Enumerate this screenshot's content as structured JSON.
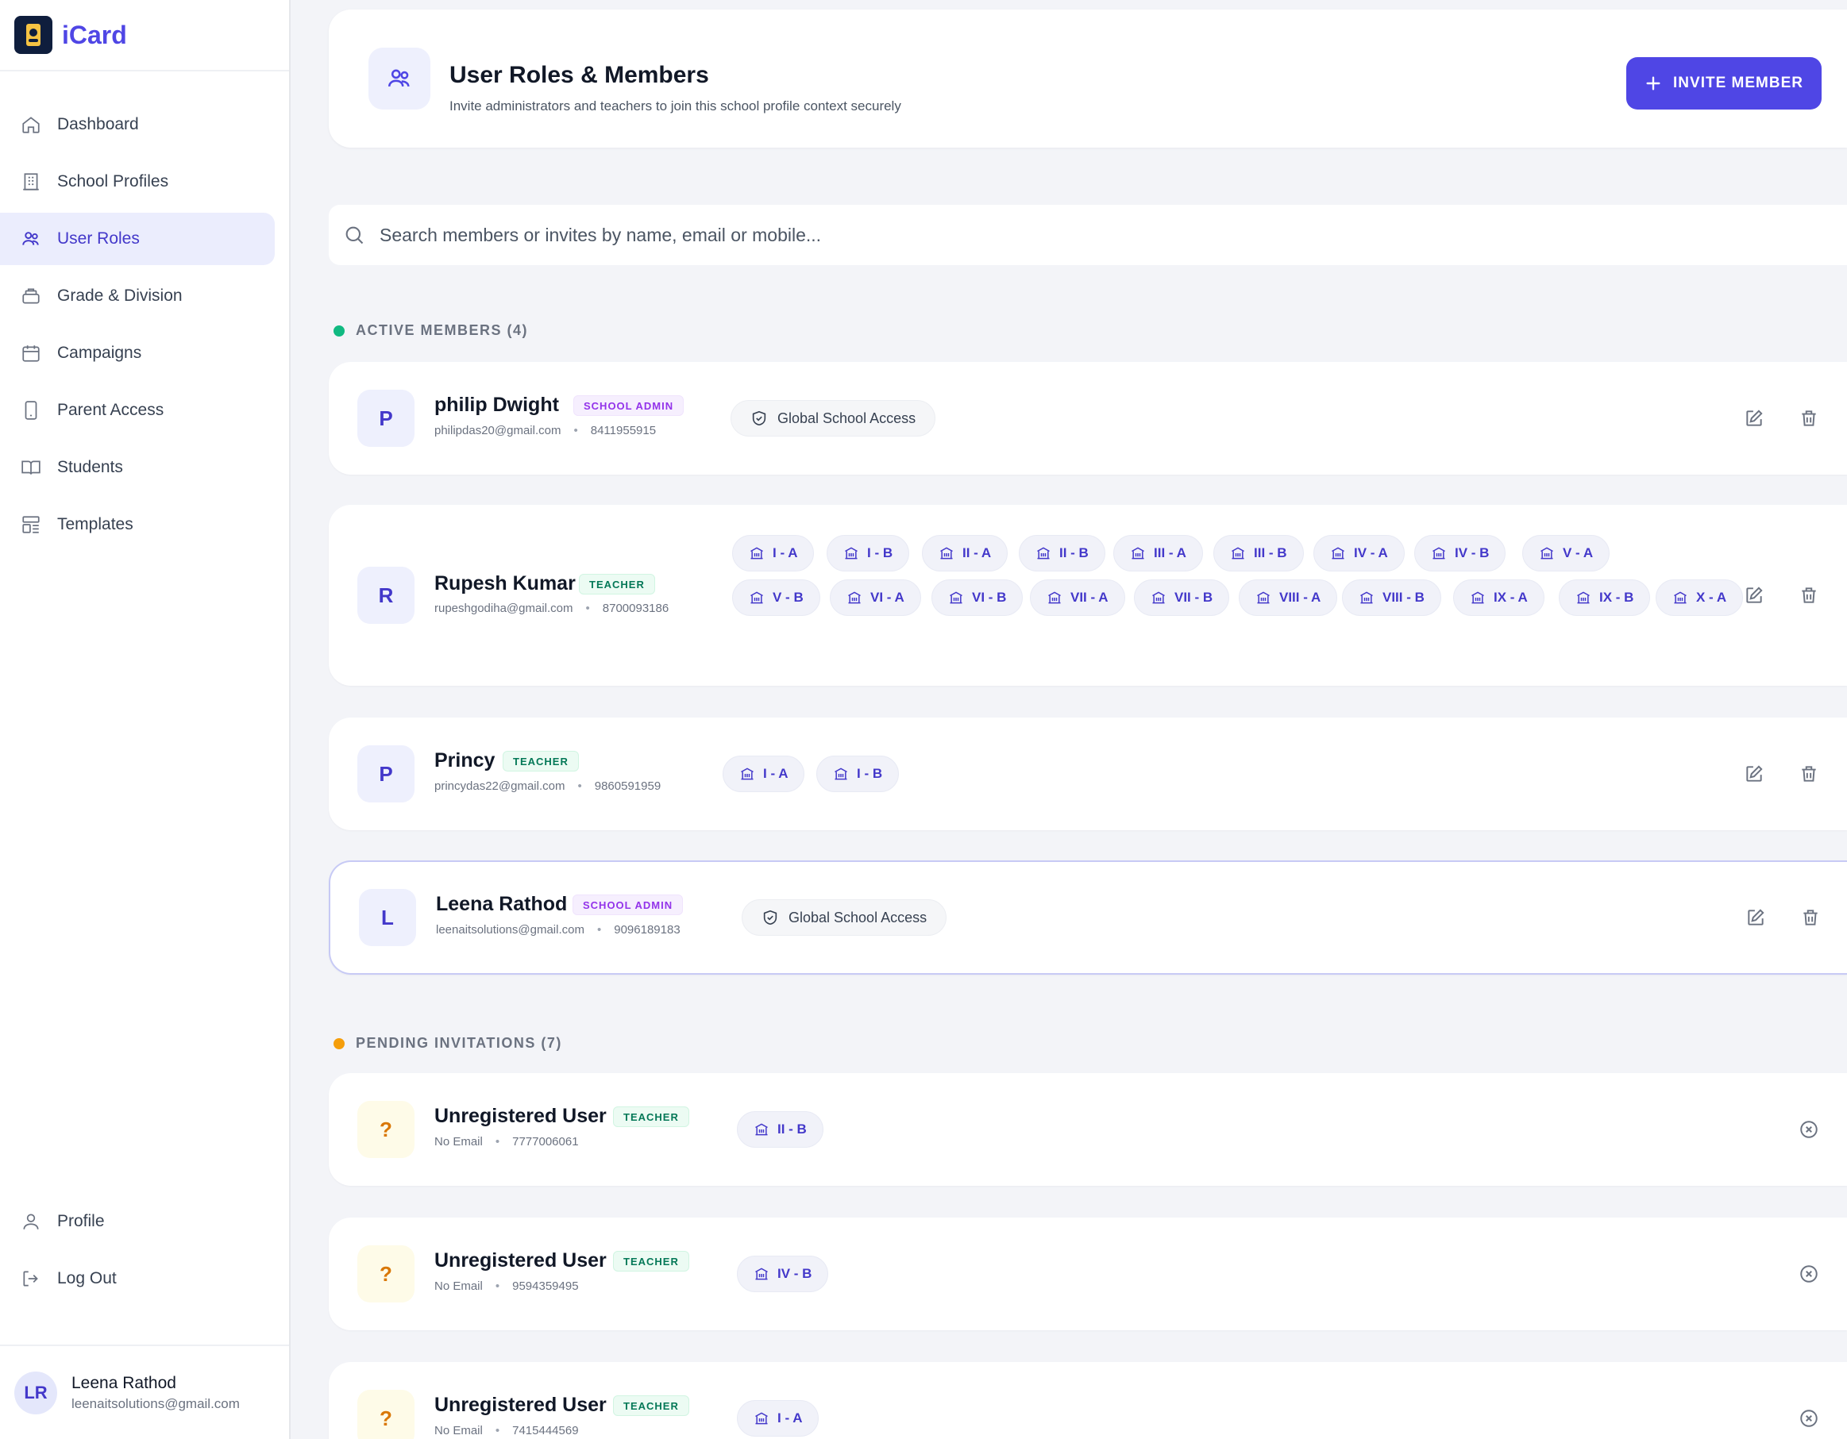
{
  "app": {
    "name": "iCard"
  },
  "sidebar": {
    "nav": [
      {
        "label": "Dashboard",
        "icon": "home-icon"
      },
      {
        "label": "School Profiles",
        "icon": "building-icon"
      },
      {
        "label": "User Roles",
        "icon": "users-icon",
        "active": true
      },
      {
        "label": "Grade & Division",
        "icon": "layers-icon"
      },
      {
        "label": "Campaigns",
        "icon": "calendar-icon"
      },
      {
        "label": "Parent Access",
        "icon": "tablet-icon"
      },
      {
        "label": "Students",
        "icon": "book-icon"
      },
      {
        "label": "Templates",
        "icon": "layout-icon"
      }
    ],
    "bottom": [
      {
        "label": "Profile",
        "icon": "user-icon"
      },
      {
        "label": "Log Out",
        "icon": "logout-icon"
      }
    ],
    "user": {
      "initials": "LR",
      "name": "Leena Rathod",
      "email": "leenaitsolutions@gmail.com"
    }
  },
  "header": {
    "title": "User Roles & Members",
    "subtitle": "Invite administrators and teachers to join this school profile context securely",
    "invite_label": "INVITE MEMBER"
  },
  "search": {
    "placeholder": "Search members or invites by name, email or mobile..."
  },
  "active": {
    "heading": "ACTIVE MEMBERS (4)",
    "members": [
      {
        "initial": "P",
        "name": "philip Dwight",
        "role": "SCHOOL ADMIN",
        "email": "philipdas20@gmail.com",
        "mobile": "8411955915",
        "access": "Global School Access",
        "divisions": []
      },
      {
        "initial": "R",
        "name": "Rupesh Kumar",
        "role": "TEACHER",
        "email": "rupeshgodiha@gmail.com",
        "mobile": "8700093186",
        "access": "",
        "divisions": [
          "I - A",
          "I - B",
          "II - A",
          "II - B",
          "III - A",
          "III - B",
          "IV - A",
          "IV - B",
          "V - A",
          "V - B",
          "VI - A",
          "VI - B",
          "VII - A",
          "VII - B",
          "VIII - A",
          "VIII - B",
          "IX - A",
          "IX - B",
          "X - A"
        ]
      },
      {
        "initial": "P",
        "name": "Princy",
        "role": "TEACHER",
        "email": "princydas22@gmail.com",
        "mobile": "9860591959",
        "access": "",
        "divisions": [
          "I - A",
          "I - B"
        ]
      },
      {
        "initial": "L",
        "name": "Leena Rathod",
        "role": "SCHOOL ADMIN",
        "email": "leenaitsolutions@gmail.com",
        "mobile": "9096189183",
        "access": "Global School Access",
        "divisions": []
      }
    ]
  },
  "pending": {
    "heading": "PENDING INVITATIONS (7)",
    "invites": [
      {
        "initial": "?",
        "name": "Unregistered User",
        "role": "TEACHER",
        "email": "No Email",
        "mobile": "7777006061",
        "divisions": [
          "II - B"
        ]
      },
      {
        "initial": "?",
        "name": "Unregistered User",
        "role": "TEACHER",
        "email": "No Email",
        "mobile": "9594359495",
        "divisions": [
          "IV - B"
        ]
      },
      {
        "initial": "?",
        "name": "Unregistered User",
        "role": "TEACHER",
        "email": "No Email",
        "mobile": "7415444569",
        "divisions": [
          "I - A"
        ]
      }
    ]
  },
  "colors": {
    "accent": "#4f46e5",
    "active_dot": "#10b981",
    "pending_dot": "#f59e0b"
  }
}
